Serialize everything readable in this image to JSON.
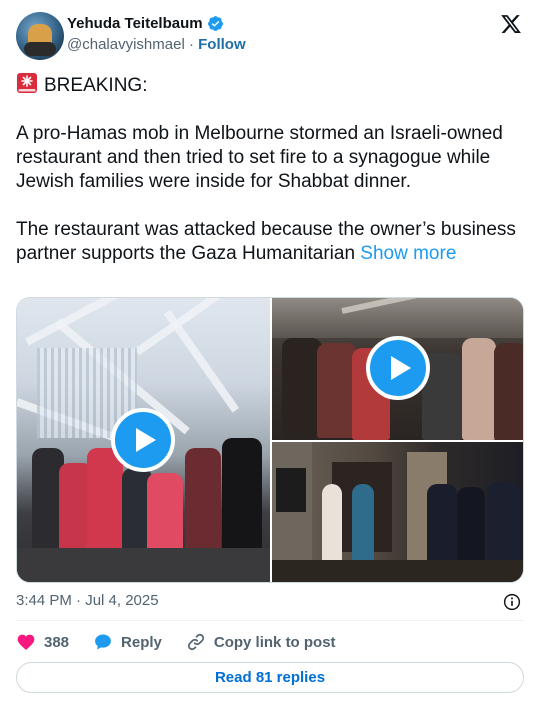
{
  "author": {
    "display_name": "Yehuda Teitelbaum",
    "handle": "@chalavyishmael",
    "separator": " · ",
    "follow_label": "Follow"
  },
  "tweet": {
    "line1": "BREAKING:",
    "para1": "A pro-Hamas mob in Melbourne stormed an Israeli-owned restaurant and then tried to set fire to a synagogue while Jewish families were inside for Shabbat dinner.",
    "para2": "The restaurant was attacked because the owner’s business partner supports the Gaza Humanitarian",
    "show_more": "Show more",
    "timestamp": "3:44 PM · Jul 4, 2025"
  },
  "actions": {
    "likes": "388",
    "reply_label": "Reply",
    "copy_label": "Copy link to post",
    "read_replies_label": "Read 81 replies"
  },
  "colors": {
    "accent": "#1d9bf0",
    "follow": "#1d6fa5",
    "like": "#f91880",
    "text": "#0f1419",
    "muted": "#536471"
  }
}
